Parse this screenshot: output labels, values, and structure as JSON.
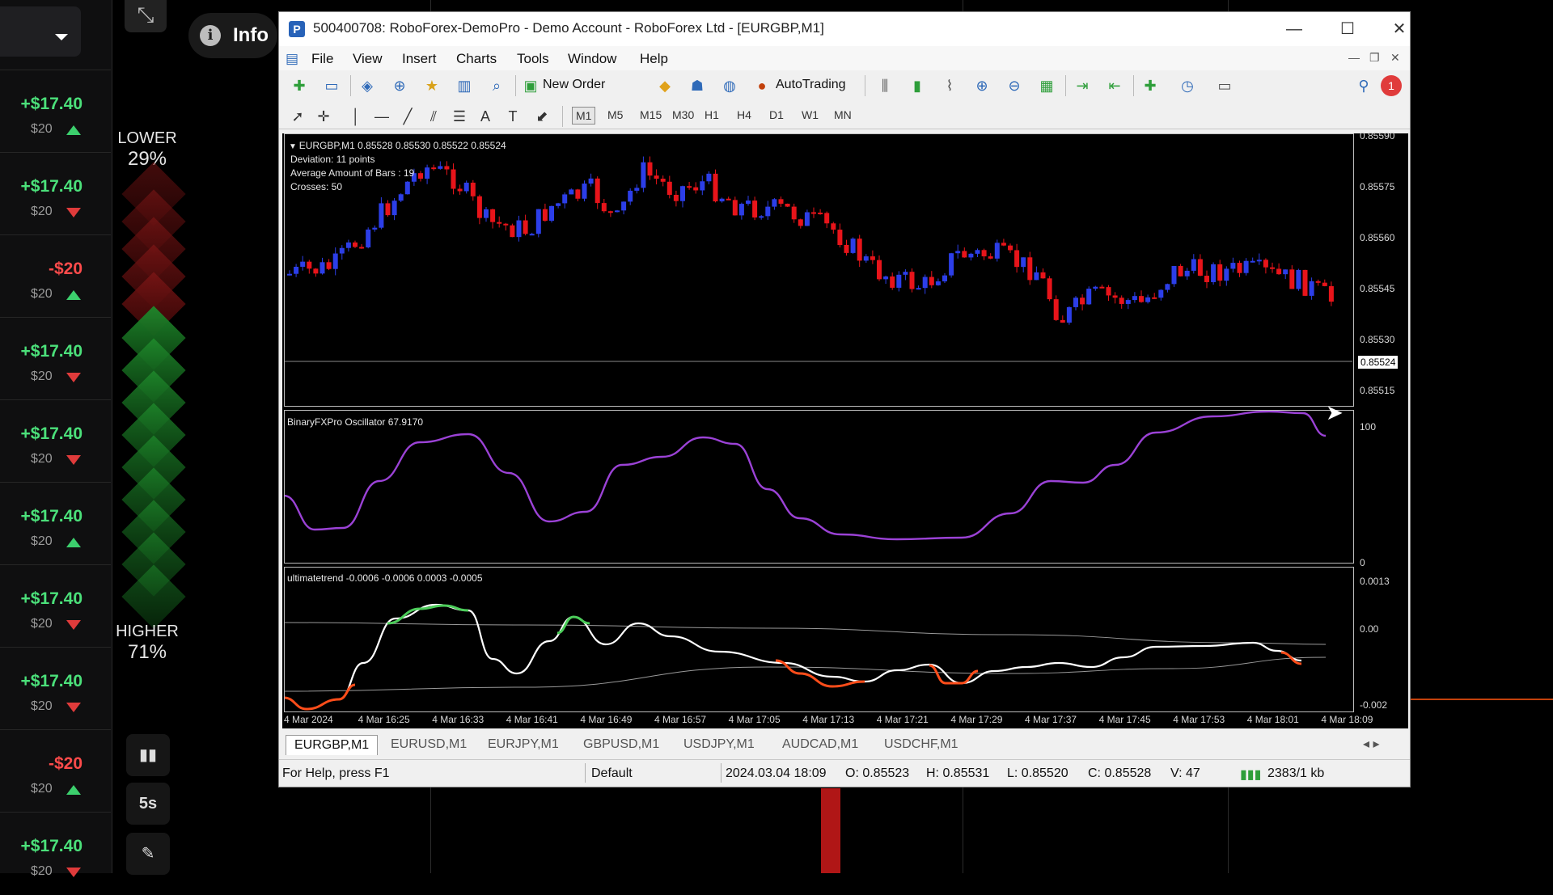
{
  "left_panel": {
    "trades": [
      {
        "profit": "+$17.40",
        "stake": "$20",
        "direction": "up"
      },
      {
        "profit": "+$17.40",
        "stake": "$20",
        "direction": "down"
      },
      {
        "profit": "-$20",
        "stake": "$20",
        "direction": "up"
      },
      {
        "profit": "+$17.40",
        "stake": "$20",
        "direction": "down"
      },
      {
        "profit": "+$17.40",
        "stake": "$20",
        "direction": "down"
      },
      {
        "profit": "+$17.40",
        "stake": "$20",
        "direction": "up"
      },
      {
        "profit": "+$17.40",
        "stake": "$20",
        "direction": "down"
      },
      {
        "profit": "+$17.40",
        "stake": "$20",
        "direction": "down"
      },
      {
        "profit": "-$20",
        "stake": "$20",
        "direction": "up"
      },
      {
        "profit": "+$17.40",
        "stake": "$20",
        "direction": "down"
      }
    ]
  },
  "sentiment": {
    "lower_label": "LOWER",
    "lower_pct": "29%",
    "higher_label": "HIGHER",
    "higher_pct": "71%",
    "timer_label": "5s"
  },
  "info_pill": {
    "label": "Info"
  },
  "window": {
    "title": "500400708: RoboForex-DemoPro - Demo Account - RoboForex Ltd - [EURGBP,M1]",
    "menu": [
      "File",
      "View",
      "Insert",
      "Charts",
      "Tools",
      "Window",
      "Help"
    ],
    "toolbar": {
      "new_order": "New Order",
      "autotrading": "AutoTrading",
      "alerts_count": "1"
    },
    "timeframes": [
      "M1",
      "M5",
      "M15",
      "M30",
      "H1",
      "H4",
      "D1",
      "W1",
      "MN"
    ],
    "active_timeframe": "M1",
    "main_pane": {
      "header": "EURGBP,M1  0.85528 0.85530 0.85522 0.85524",
      "info": [
        "Deviation: 11 points",
        "Average Amount of Bars : 19",
        "Crosses: 50"
      ],
      "price_labels": [
        "0.85590",
        "0.85575",
        "0.85560",
        "0.85545",
        "0.85530",
        "0.85515"
      ],
      "current_price": "0.85524"
    },
    "osc_pane": {
      "header": "BinaryFXPro Oscillator 67.9170",
      "labels": [
        "100",
        "0"
      ]
    },
    "trend_pane": {
      "header": "ultimatetrend -0.0006 -0.0006 0.0003 -0.0005",
      "labels": [
        "0.0013",
        "0.00",
        "-0.002"
      ]
    },
    "time_labels": [
      "4 Mar 2024",
      "4 Mar 16:25",
      "4 Mar 16:33",
      "4 Mar 16:41",
      "4 Mar 16:49",
      "4 Mar 16:57",
      "4 Mar 17:05",
      "4 Mar 17:13",
      "4 Mar 17:21",
      "4 Mar 17:29",
      "4 Mar 17:37",
      "4 Mar 17:45",
      "4 Mar 17:53",
      "4 Mar 18:01",
      "4 Mar 18:09"
    ],
    "tabs": [
      "EURGBP,M1",
      "EURUSD,M1",
      "EURJPY,M1",
      "GBPUSD,M1",
      "USDJPY,M1",
      "AUDCAD,M1",
      "USDCHF,M1"
    ],
    "status": {
      "help": "For Help, press F1",
      "profile": "Default",
      "datetime": "2024.03.04 18:09",
      "open": "O: 0.85523",
      "high": "H: 0.85531",
      "low": "L: 0.85520",
      "close": "C: 0.85528",
      "volume": "V: 47",
      "traffic": "2383/1 kb"
    }
  },
  "colors": {
    "bull": "#2c3ee8",
    "bear": "#e8141a",
    "oscillator": "#9b42d6",
    "trend_up": "#4ccd5a",
    "trend_down": "#ff4d1a"
  }
}
